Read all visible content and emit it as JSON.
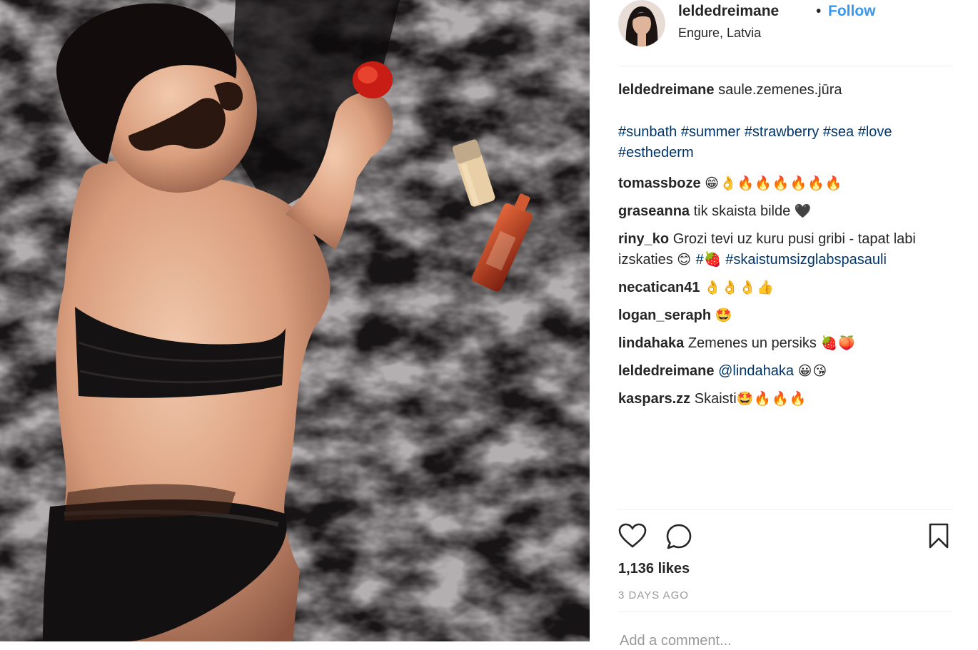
{
  "author": {
    "username": "leldedreimane",
    "separator": "•",
    "follow_label": "Follow",
    "location": "Engure, Latvia"
  },
  "caption": {
    "user": "leldedreimane",
    "text": "saule.zemenes.jūra",
    "hashtags_line1": "#sunbath #summer #strawberry #sea #love",
    "hashtags_line2": "#esthederm"
  },
  "comments": [
    {
      "user": "tomassboze",
      "text": "",
      "emoji": "😁👌🔥🔥🔥🔥🔥🔥"
    },
    {
      "user": "graseanna",
      "text": "tik skaista bilde",
      "emoji": "🖤"
    },
    {
      "user": "riny_ko",
      "text": "Grozi tevi uz kuru pusi gribi - tapat labi izskaties",
      "emoji": "😊",
      "hashtag1": "#🍓",
      "hashtag2": "#skaistumsizglabspasauli"
    },
    {
      "user": "necatican41",
      "text": "",
      "emoji": "👌👌👌👍"
    },
    {
      "user": "logan_seraph",
      "text": "",
      "emoji": "🤩"
    },
    {
      "user": "lindahaka",
      "text": "Zemenes un persiks",
      "emoji": "🍓🍑"
    },
    {
      "user": "leldedreimane",
      "mention": "@lindahaka",
      "emoji": "😀😘"
    },
    {
      "user": "kaspars.zz",
      "text": "Skaisti",
      "emoji": "🤩🔥🔥🔥"
    }
  ],
  "stats": {
    "likes": "1,136 likes",
    "timestamp": "3 DAYS AGO"
  },
  "add_comment": {
    "placeholder": "Add a comment..."
  },
  "icons": {
    "like": "heart-icon",
    "comment": "comment-bubble-icon",
    "save": "bookmark-icon"
  },
  "colors": {
    "link": "#3897f0",
    "hashtag": "#003569",
    "muted": "#999999"
  }
}
